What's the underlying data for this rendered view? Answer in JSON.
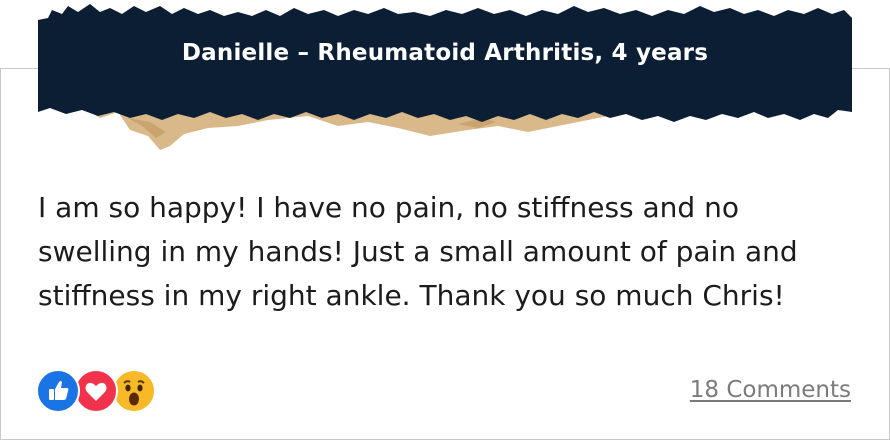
{
  "testimonial": {
    "header": "Danielle – Rheumatoid Arthritis, 4 years",
    "text": "I am so happy! I have no pain, no stiffness and no swelling in my hands! Just a small amount of pain and stiffness in my right ankle. Thank you so much Chris!",
    "comments_label": "18 Comments"
  },
  "reactions": [
    "like-icon",
    "love-icon",
    "wow-icon"
  ],
  "colors": {
    "banner_navy": "#0b1e33",
    "torn_paper": "#d9b98a",
    "like_blue": "#1b74e4",
    "love_red": "#f0334b",
    "wow_yellow": "#f7b928"
  }
}
